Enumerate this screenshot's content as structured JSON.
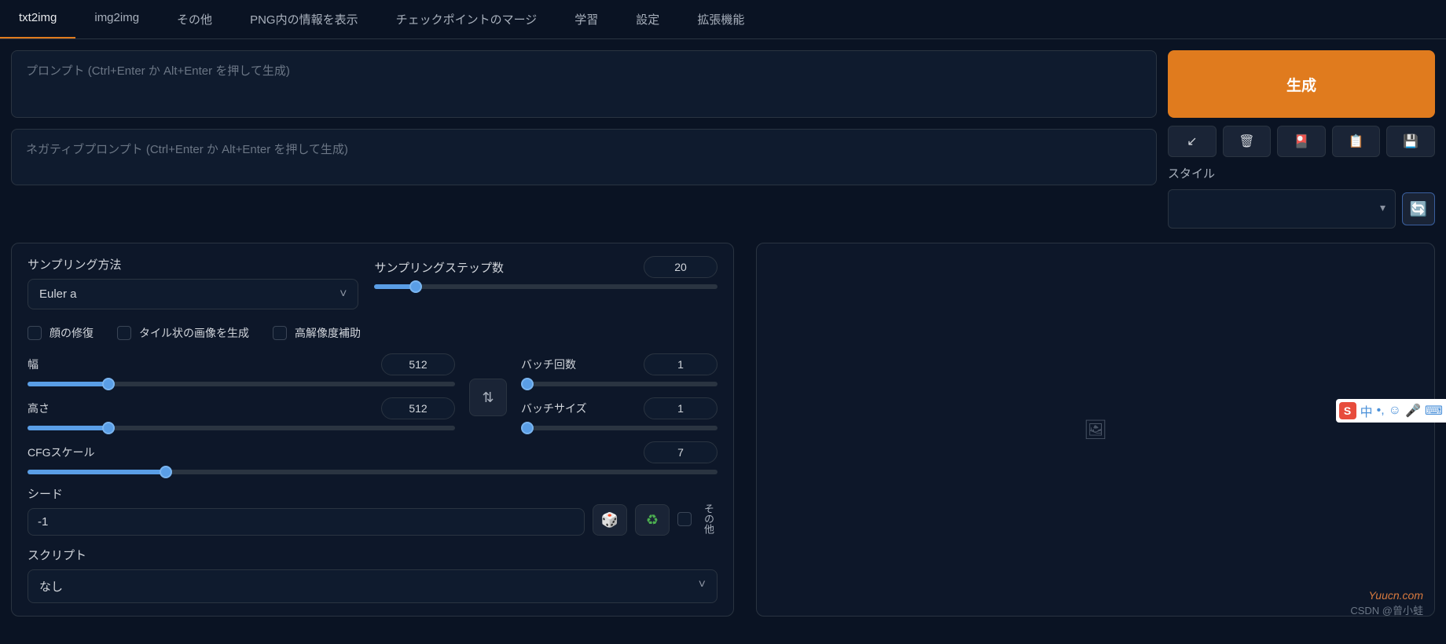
{
  "tabs": [
    "txt2img",
    "img2img",
    "その他",
    "PNG内の情報を表示",
    "チェックポイントのマージ",
    "学習",
    "設定",
    "拡張機能"
  ],
  "active_tab": 0,
  "prompt": {
    "placeholder": "プロンプト (Ctrl+Enter か Alt+Enter を押して生成)"
  },
  "neg_prompt": {
    "placeholder": "ネガティブプロンプト (Ctrl+Enter か Alt+Enter を押して生成)"
  },
  "generate": "生成",
  "style_label": "スタイル",
  "sampling": {
    "method_label": "サンプリング方法",
    "method_value": "Euler a",
    "steps_label": "サンプリングステップ数",
    "steps_value": "20",
    "steps_pct": 12
  },
  "checkboxes": {
    "face": "顔の修復",
    "tiling": "タイル状の画像を生成",
    "hires": "高解像度補助"
  },
  "dims": {
    "width_label": "幅",
    "width_value": "512",
    "width_pct": 19,
    "height_label": "高さ",
    "height_value": "512",
    "height_pct": 19,
    "batch_count_label": "バッチ回数",
    "batch_count_value": "1",
    "batch_count_pct": 0,
    "batch_size_label": "バッチサイズ",
    "batch_size_value": "1",
    "batch_size_pct": 0
  },
  "cfg": {
    "label": "CFGスケール",
    "value": "7",
    "pct": 20
  },
  "seed": {
    "label": "シード",
    "value": "-1",
    "extras": "その他"
  },
  "script": {
    "label": "スクリプト",
    "value": "なし"
  },
  "watermark1": "Yuucn.com",
  "watermark2": "CSDN @曾小蛙",
  "ime": {
    "lang": "中"
  }
}
